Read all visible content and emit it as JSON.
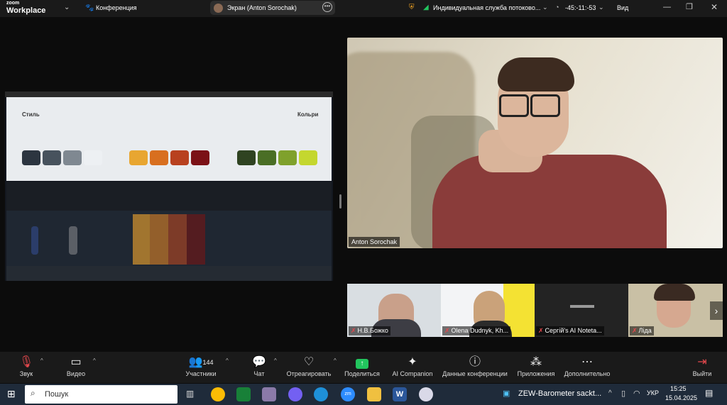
{
  "app": {
    "logo_top": "zoom",
    "logo_bottom": "Workplace"
  },
  "topbar": {
    "conference_label": "Конференция",
    "screen_label": "Экран (Anton Sorochak)",
    "stream_label": "Индивидуальная служба потоково...",
    "timer": "-45:-11:-53",
    "view_label": "Вид"
  },
  "shared_screen": {
    "left_heading": "Стиль",
    "right_heading": "Кольри",
    "palette": [
      "#2c3540",
      "#47525d",
      "#7f8891",
      "#edf0f3",
      "#e8a631",
      "#d86f1f",
      "#b8411f",
      "#7b1116",
      "#2f4321",
      "#4a6e25",
      "#7fa12c",
      "#c4d72f"
    ]
  },
  "main_video": {
    "participant_name": "Anton Sorochak"
  },
  "gallery": [
    {
      "name": "Н.В.Божко"
    },
    {
      "name": "Olena Dudnyk, Kh..."
    },
    {
      "name": "Сергій's AI Noteta..."
    },
    {
      "name": "Ліда"
    }
  ],
  "toolbar": {
    "audio": "Звук",
    "video": "Видео",
    "participants": "Участники",
    "participants_count": "144",
    "chat": "Чат",
    "react": "Отреагировать",
    "share": "Поделиться",
    "ai": "AI Companion",
    "info": "Данные конференции",
    "apps": "Приложения",
    "more": "Дополнительно",
    "leave": "Выйти"
  },
  "taskbar": {
    "search_placeholder": "Пошук",
    "news": "ZEW-Barometer sackt...",
    "lang": "УКР",
    "time": "15:25",
    "date": "15.04.2025"
  },
  "colors": {
    "share_green": "#22c55e",
    "leave_red": "#e5484d",
    "muted_red": "#e5484d"
  }
}
